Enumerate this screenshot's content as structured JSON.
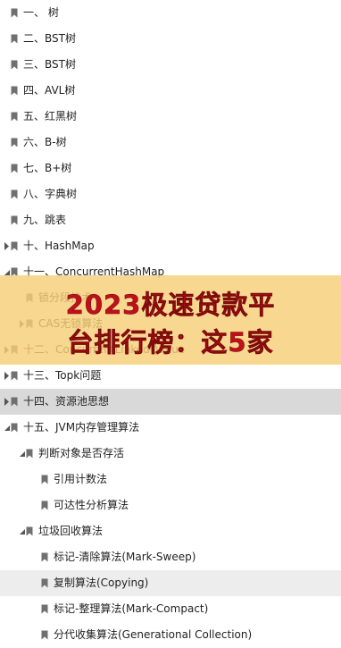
{
  "tree": [
    {
      "id": "t1",
      "label": "一、 树",
      "indent": 0,
      "toggle": null
    },
    {
      "id": "t2",
      "label": "二、BST树",
      "indent": 0,
      "toggle": null
    },
    {
      "id": "t3",
      "label": "三、BST树",
      "indent": 0,
      "toggle": null
    },
    {
      "id": "t4",
      "label": "四、AVL树",
      "indent": 0,
      "toggle": null
    },
    {
      "id": "t5",
      "label": "五、红黑树",
      "indent": 0,
      "toggle": null
    },
    {
      "id": "t6",
      "label": "六、B-树",
      "indent": 0,
      "toggle": null
    },
    {
      "id": "t7",
      "label": "七、B+树",
      "indent": 0,
      "toggle": null
    },
    {
      "id": "t8",
      "label": "八、字典树",
      "indent": 0,
      "toggle": null
    },
    {
      "id": "t9",
      "label": "九、跳表",
      "indent": 0,
      "toggle": null
    },
    {
      "id": "t10",
      "label": "十、HashMap",
      "indent": 0,
      "toggle": "collapsed"
    },
    {
      "id": "t11",
      "label": "十一、ConcurrentHashMap",
      "indent": 0,
      "toggle": "expanded"
    },
    {
      "id": "t11a",
      "label": "锁分段技术",
      "indent": 1,
      "toggle": null
    },
    {
      "id": "t11b",
      "label": "CAS无锁算法",
      "indent": 1,
      "toggle": "collapsed"
    },
    {
      "id": "t12",
      "label": "十二、ConcurrentLinkedQueue",
      "indent": 0,
      "toggle": "collapsed"
    },
    {
      "id": "t13",
      "label": "十三、Topk问题",
      "indent": 0,
      "toggle": "collapsed"
    },
    {
      "id": "t14",
      "label": "十四、资源池思想",
      "indent": 0,
      "toggle": "collapsed",
      "state": "selected"
    },
    {
      "id": "t15",
      "label": "十五、JVM内存管理算法",
      "indent": 0,
      "toggle": "expanded"
    },
    {
      "id": "t15a",
      "label": "判断对象是否存活",
      "indent": 1,
      "toggle": "expanded"
    },
    {
      "id": "t15a1",
      "label": "引用计数法",
      "indent": 2,
      "toggle": null
    },
    {
      "id": "t15a2",
      "label": "可达性分析算法",
      "indent": 2,
      "toggle": null
    },
    {
      "id": "t15b",
      "label": "垃圾回收算法",
      "indent": 1,
      "toggle": "expanded"
    },
    {
      "id": "t15b1",
      "label": "标记-清除算法(Mark-Sweep)",
      "indent": 2,
      "toggle": null
    },
    {
      "id": "t15b2",
      "label": "复制算法(Copying)",
      "indent": 2,
      "toggle": null,
      "state": "highlight"
    },
    {
      "id": "t15b3",
      "label": "标记-整理算法(Mark-Compact)",
      "indent": 2,
      "toggle": null
    },
    {
      "id": "t15b4",
      "label": "分代收集算法(Generational Collection)",
      "indent": 2,
      "toggle": null
    }
  ],
  "overlay": {
    "line1": "2023极速贷款平",
    "line2": "台排行榜：这5家"
  },
  "colors": {
    "bookmark": "#707070",
    "toggle": "#555555",
    "selected_bg": "#d9d9d9",
    "highlight_bg": "#ededed",
    "overlay_bg": "#f6ce78",
    "overlay_text": "#c0101a"
  },
  "icons": {
    "bookmark": "bookmark-icon",
    "collapsed": "triangle-right-icon",
    "expanded": "triangle-down-icon"
  }
}
